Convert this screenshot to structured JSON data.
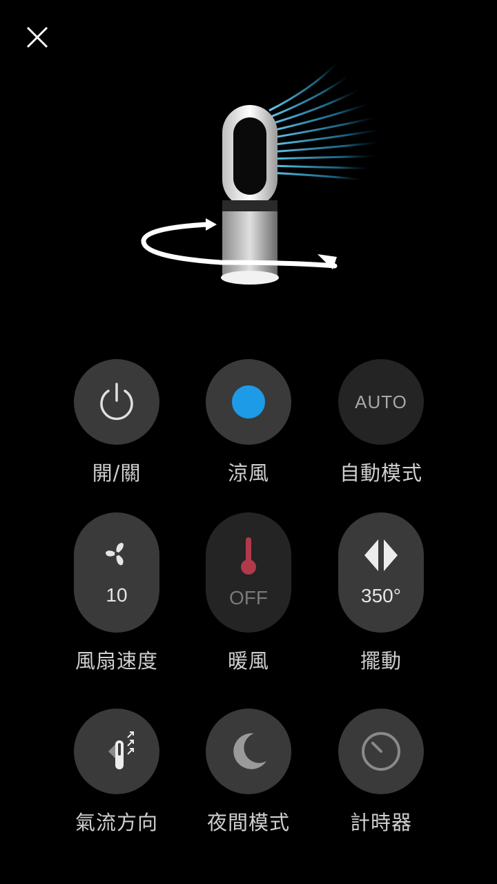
{
  "controls": {
    "power": {
      "label": "開/關",
      "icon": "power-icon"
    },
    "cool": {
      "label": "涼風",
      "icon": "blue-dot-icon",
      "accent": "#1d9be6"
    },
    "auto": {
      "label": "自動模式",
      "value": "AUTO"
    },
    "fan_speed": {
      "label": "風扇速度",
      "value": "10",
      "icon": "fan-icon"
    },
    "heat": {
      "label": "暖風",
      "value": "OFF",
      "icon": "thermometer-icon",
      "accent": "#b03a4a"
    },
    "oscillation": {
      "label": "擺動",
      "value": "350°",
      "icon": "oscillation-arrows-icon"
    },
    "airflow": {
      "label": "氣流方向",
      "icon": "airflow-direction-icon"
    },
    "night": {
      "label": "夜間模式",
      "icon": "moon-icon"
    },
    "timer": {
      "label": "計時器",
      "icon": "timer-icon"
    }
  }
}
